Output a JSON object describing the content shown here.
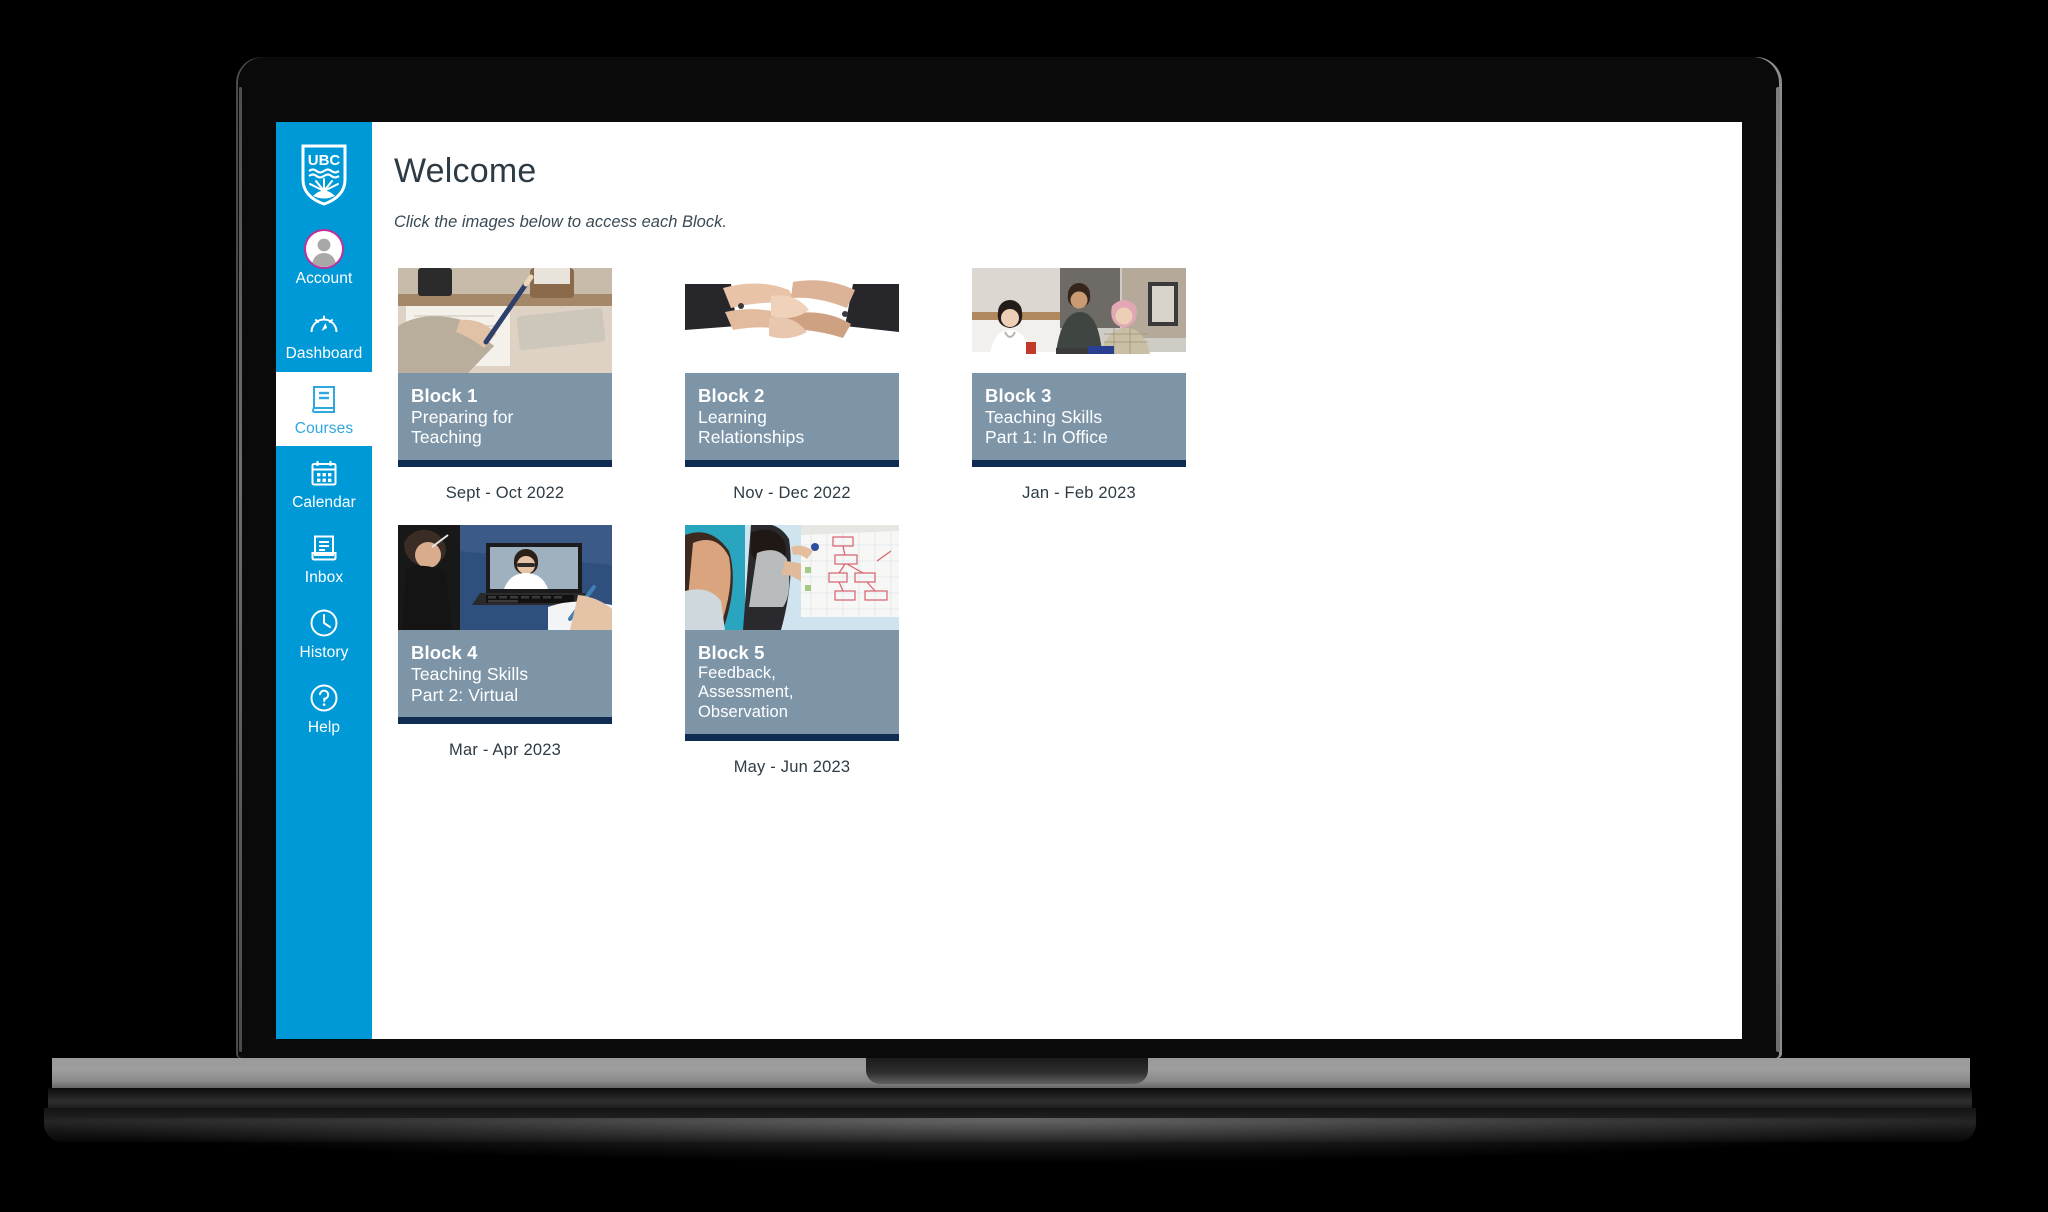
{
  "app": {
    "brand_logo": "ubc-shield-logo",
    "accent_blue": "#0099d8",
    "active_text_blue": "#2fa8e0",
    "caption_band": "#7e95a8",
    "rule_navy": "#0f2d52",
    "text_dark": "#2d3b45",
    "avatar_ring": "#c0309a"
  },
  "sidebar": {
    "items": [
      {
        "label": "Account",
        "icon": "user-avatar-icon",
        "active": false
      },
      {
        "label": "Dashboard",
        "icon": "gauge-icon",
        "active": false
      },
      {
        "label": "Courses",
        "icon": "book-icon",
        "active": true
      },
      {
        "label": "Calendar",
        "icon": "calendar-icon",
        "active": false
      },
      {
        "label": "Inbox",
        "icon": "inbox-tray-icon",
        "active": false
      },
      {
        "label": "History",
        "icon": "clock-icon",
        "active": false
      },
      {
        "label": "Help",
        "icon": "question-circle-icon",
        "active": false
      }
    ]
  },
  "main": {
    "title": "Welcome",
    "subtitle": "Click the images below to access each Block.",
    "cards": [
      {
        "number": "Block 1",
        "title": "Preparing for\nTeaching",
        "date": "Sept - Oct 2022",
        "photo": "person-writing-notes-photo"
      },
      {
        "number": "Block 2",
        "title": "Learning\nRelationships",
        "date": "Nov - Dec 2022",
        "photo": "hands-joined-photo"
      },
      {
        "number": "Block 3",
        "title": "Teaching Skills\nPart 1: In Office",
        "date": "Jan - Feb 2023",
        "photo": "doctor-with-patient-photo"
      },
      {
        "number": "Block 4",
        "title": "Teaching Skills\nPart 2: Virtual",
        "date": "Mar - Apr 2023",
        "photo": "video-call-laptop-photo"
      },
      {
        "number": "Block 5",
        "title": "Feedback,\nAssessment,\nObservation",
        "date": "May - Jun 2023",
        "photo": "flipchart-presentation-photo"
      }
    ]
  }
}
